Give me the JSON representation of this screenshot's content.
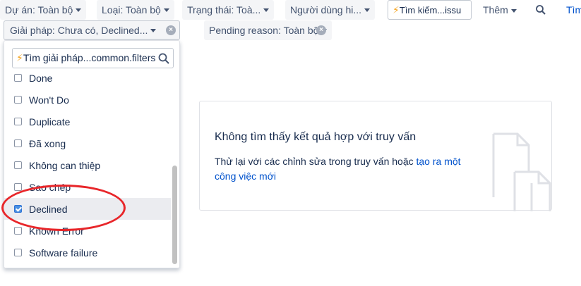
{
  "filters": {
    "project": "Dự án: Toàn bộ",
    "type": "Loại: Toàn bộ",
    "status": "Trạng thái: Toà...",
    "assignee": "Người dùng hi...",
    "search_value": "Tìm kiếm...issu",
    "more": "Thêm",
    "switcher": "Tìm",
    "resolution": "Giải pháp: Chưa có, Declined...",
    "pending_reason": "Pending reason: Toàn bộ"
  },
  "resolution_dropdown": {
    "search_value": "Tìm giải pháp...common.filters",
    "items": [
      {
        "label": "Done",
        "checked": false
      },
      {
        "label": "Won't Do",
        "checked": false
      },
      {
        "label": "Duplicate",
        "checked": false
      },
      {
        "label": "Đã xong",
        "checked": false
      },
      {
        "label": "Không can thiệp",
        "checked": false
      },
      {
        "label": "Sao chép",
        "checked": false
      },
      {
        "label": "Declined",
        "checked": true
      },
      {
        "label": "Known Error",
        "checked": false
      },
      {
        "label": "Software failure",
        "checked": false
      }
    ]
  },
  "empty_state": {
    "title": "Không tìm thấy kết quả hợp với truy vấn",
    "body": "Thử lại với các chỉnh sửa trong truy vấn hoặc",
    "link": "tạo ra một công việc mới"
  },
  "icons": {
    "bolt": "⚡",
    "search": "search-icon",
    "clear": "×"
  },
  "colors": {
    "accent": "#0052cc",
    "checkbox": "#4a90e2",
    "highlight": "#e8262a"
  }
}
